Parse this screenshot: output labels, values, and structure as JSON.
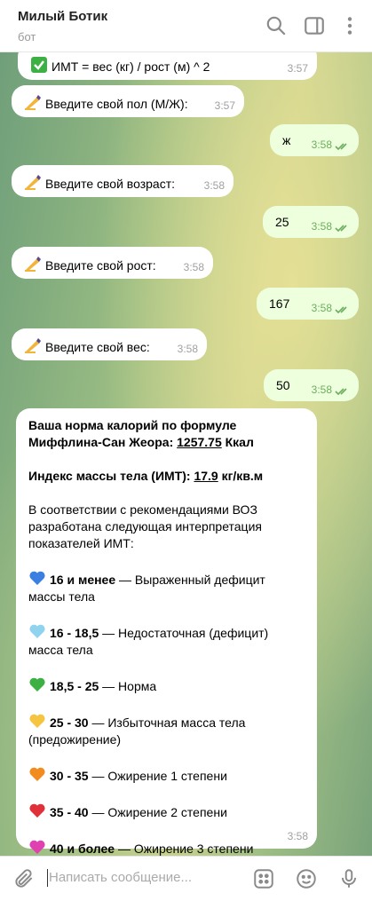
{
  "header": {
    "name": "Милый Ботик",
    "status": "бот"
  },
  "messages": [
    {
      "text": "ИМТ = вес (кг) / рост (м) ^ 2",
      "time": "3:57",
      "emoji": "check"
    },
    {
      "text": "Введите свой пол (М/Ж):",
      "time": "3:57",
      "emoji": "writing-hand"
    },
    {
      "text": "ж",
      "time": "3:58"
    },
    {
      "text": "Введите свой возраст:",
      "time": "3:58",
      "emoji": "writing-hand"
    },
    {
      "text": "25",
      "time": "3:58"
    },
    {
      "text": "Введите свой рост:",
      "time": "3:58",
      "emoji": "writing-hand"
    },
    {
      "text": "167",
      "time": "3:58"
    },
    {
      "text": "Введите свой вес:",
      "time": "3:58",
      "emoji": "writing-hand"
    },
    {
      "text": "50",
      "time": "3:58"
    }
  ],
  "result": {
    "calories_label": "Ваша норма калорий по формуле Миффлина-Сан Жеора:",
    "calories_value": "1257.75",
    "calories_unit": "Ккал",
    "bmi_label": "Индекс массы тела (ИМТ):",
    "bmi_value": "17.9",
    "bmi_unit": "кг/кв.м",
    "intro": "В соответствии с рекомендациями ВОЗ разработана следующая интерпретация показателей ИМТ:",
    "ranges": [
      {
        "range": "16 и менее",
        "desc": " — Выраженный дефицит массы тела",
        "color": "#3b7fe0"
      },
      {
        "range": "16 - 18,5",
        "desc": " — Недостаточная (дефицит) масса тела",
        "color": "#8fd3ee"
      },
      {
        "range": "18,5 - 25",
        "desc": " — Норма",
        "color": "#3cb043"
      },
      {
        "range": "25 - 30",
        "desc": " — Избыточная масса тела (предожирение)",
        "color": "#f5c542"
      },
      {
        "range": "30 - 35",
        "desc": " — Ожирение 1 степени",
        "color": "#f28c1e"
      },
      {
        "range": "35 - 40",
        "desc": " — Ожирение 2 степени",
        "color": "#e0303a"
      },
      {
        "range": "40 и более",
        "desc": " — Ожирение 3 степени",
        "color": "#e040b0"
      }
    ],
    "time": "3:58"
  },
  "input": {
    "placeholder": "Написать сообщение..."
  }
}
